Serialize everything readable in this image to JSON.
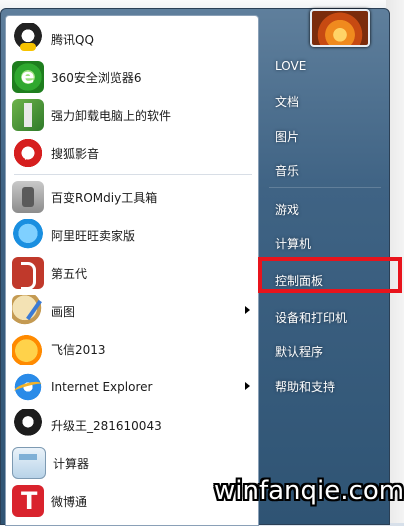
{
  "left_items": [
    {
      "label": "腾讯QQ",
      "icon": "qq-icon"
    },
    {
      "label": "360安全浏览器6",
      "icon": "browser-360-icon"
    },
    {
      "label": "强力卸载电脑上的软件",
      "icon": "uninstaller-icon"
    },
    {
      "label": "搜狐影音",
      "icon": "sohu-video-icon"
    },
    {
      "label": "百变ROMdiy工具箱",
      "icon": "rom-toolbox-icon"
    },
    {
      "label": "阿里旺旺卖家版",
      "icon": "aliwangwang-icon"
    },
    {
      "label": "第五代",
      "icon": "fifth-gen-icon"
    },
    {
      "label": "画图",
      "icon": "paint-icon",
      "submenu": true
    },
    {
      "label": "飞信2013",
      "icon": "fetion-icon"
    },
    {
      "label": "Internet Explorer",
      "icon": "ie-icon",
      "submenu": true
    },
    {
      "label": "升级王_281610043",
      "icon": "penguin-icon"
    },
    {
      "label": "计算器",
      "icon": "calculator-icon"
    },
    {
      "label": "微博通",
      "icon": "weibotong-icon"
    }
  ],
  "right_items": [
    {
      "label": "LOVE"
    },
    {
      "label": "文档"
    },
    {
      "label": "图片"
    },
    {
      "label": "音乐"
    },
    {
      "label": "游戏"
    },
    {
      "label": "计算机"
    },
    {
      "label": "控制面板"
    },
    {
      "label": "设备和打印机"
    },
    {
      "label": "默认程序"
    },
    {
      "label": "帮助和支持"
    }
  ],
  "highlighted_item": "控制面板",
  "highlight_color": "#e8141c",
  "watermark": "winfanqie.com"
}
